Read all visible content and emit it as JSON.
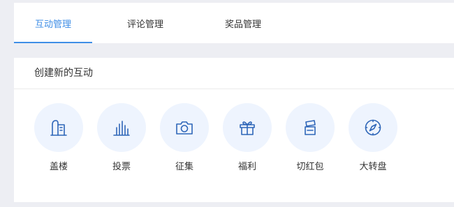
{
  "tabs": [
    {
      "label": "互动管理",
      "active": true
    },
    {
      "label": "评论管理",
      "active": false
    },
    {
      "label": "奖品管理",
      "active": false
    }
  ],
  "panel": {
    "title": "创建新的互动",
    "items": [
      {
        "label": "盖楼",
        "icon": "building-icon"
      },
      {
        "label": "投票",
        "icon": "bar-chart-icon"
      },
      {
        "label": "征集",
        "icon": "camera-icon"
      },
      {
        "label": "福利",
        "icon": "gift-icon"
      },
      {
        "label": "切红包",
        "icon": "red-packet-icon"
      },
      {
        "label": "大转盘",
        "icon": "compass-icon"
      }
    ]
  },
  "colors": {
    "accent": "#3f8ee6",
    "icon": "#2f66b8",
    "icon_bg": "#eef4fe",
    "page_bg": "#edeef3"
  }
}
